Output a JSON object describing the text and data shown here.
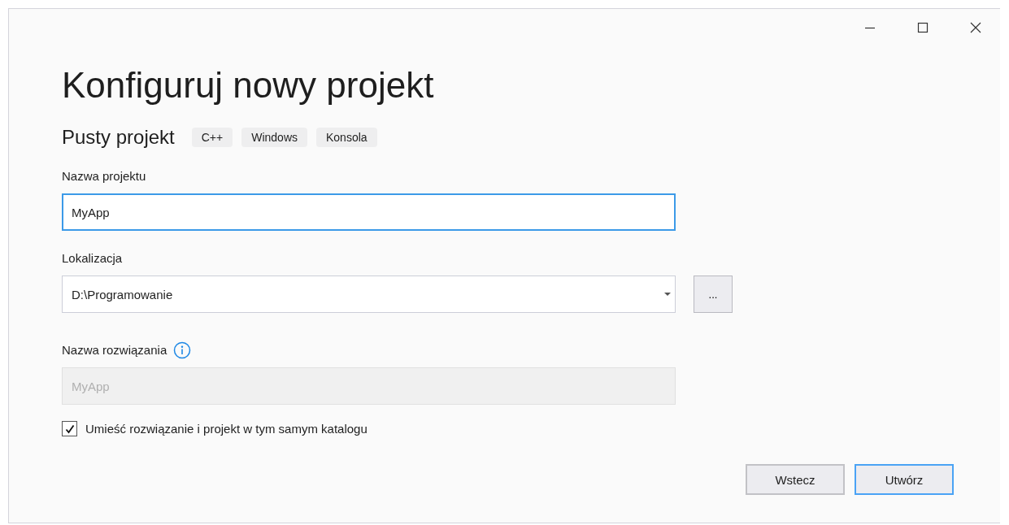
{
  "title": "Konfiguruj nowy projekt",
  "template": {
    "name": "Pusty projekt",
    "tags": [
      "C++",
      "Windows",
      "Konsola"
    ]
  },
  "project_name": {
    "label": "Nazwa projektu",
    "value": "MyApp",
    "focused": true
  },
  "location": {
    "label": "Lokalizacja",
    "value": "D:\\Programowanie",
    "browse": "..."
  },
  "solution_name": {
    "label": "Nazwa rozwiązania",
    "value": "MyApp",
    "disabled": true
  },
  "same_folder": {
    "label": "Umieść rozwiązanie i projekt w tym samym katalogu",
    "checked": true
  },
  "buttons": [
    {
      "label": "Wstecz",
      "default": false
    },
    {
      "label": "Utwórz",
      "default": true
    }
  ]
}
